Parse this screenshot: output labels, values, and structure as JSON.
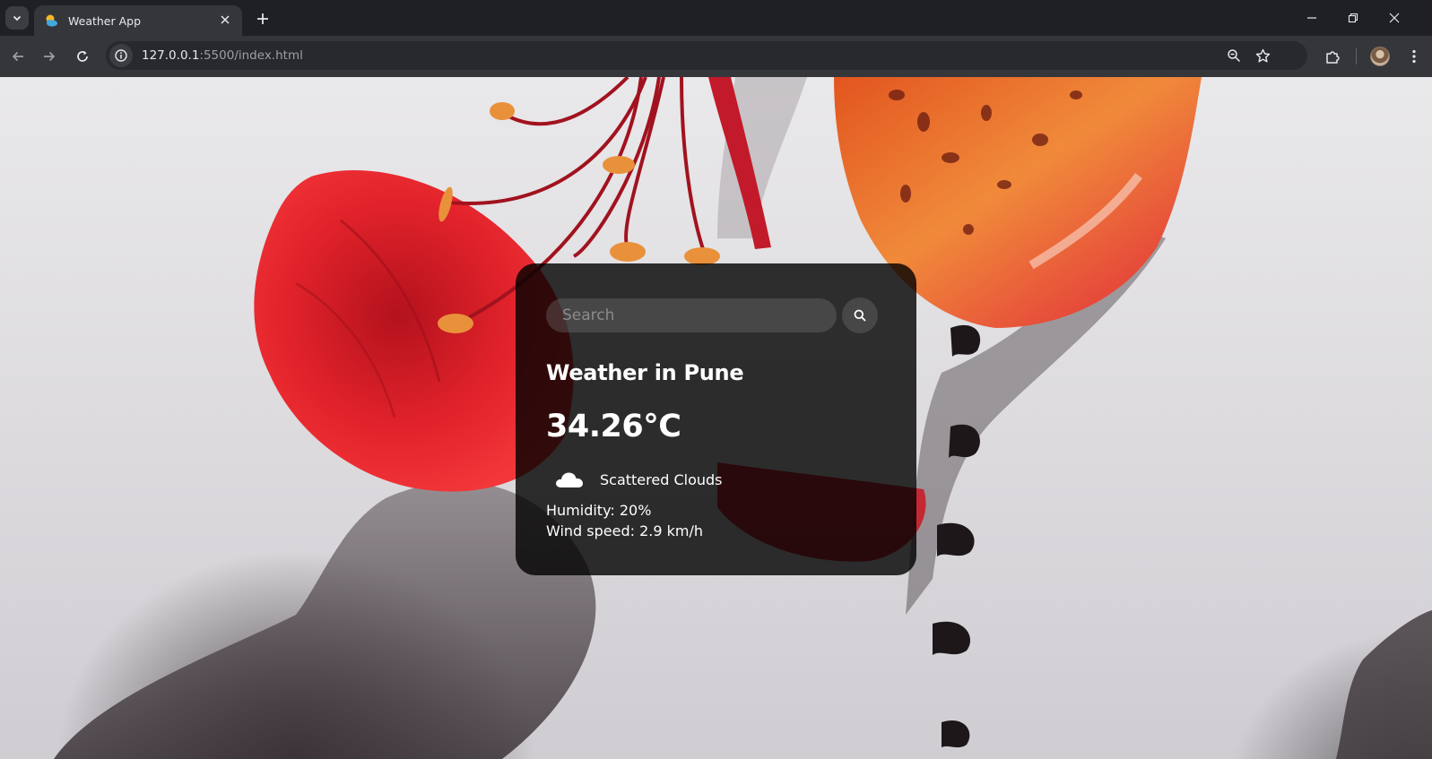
{
  "browser": {
    "tab": {
      "title": "Weather App",
      "favicon": "weather-sun-cloud-icon"
    },
    "url": {
      "host": "127.0.0.1",
      "path": ":5500/index.html"
    },
    "icons": {
      "tab_menu": "chevron-down-icon",
      "tab_close": "close-icon",
      "new_tab": "plus-icon",
      "back": "arrow-left-icon",
      "forward": "arrow-right-icon",
      "reload": "reload-icon",
      "site_info": "info-icon",
      "zoom": "zoom-icon",
      "bookmark": "star-icon",
      "extensions": "puzzle-icon",
      "profile": "avatar",
      "menu": "kebab-menu-icon"
    }
  },
  "weather": {
    "search": {
      "placeholder": "Search"
    },
    "city_title": "Weather in Pune",
    "temperature": "34.26°C",
    "description": "Scattered Clouds",
    "description_icon": "cloud-icon",
    "humidity": "Humidity: 20%",
    "wind": "Wind speed: 2.9 km/h"
  },
  "colors": {
    "card_background": "#000000cc",
    "flower_red": "#e3232b",
    "flower_orange": "#f07a2a",
    "wall": "#e8e7e9"
  }
}
